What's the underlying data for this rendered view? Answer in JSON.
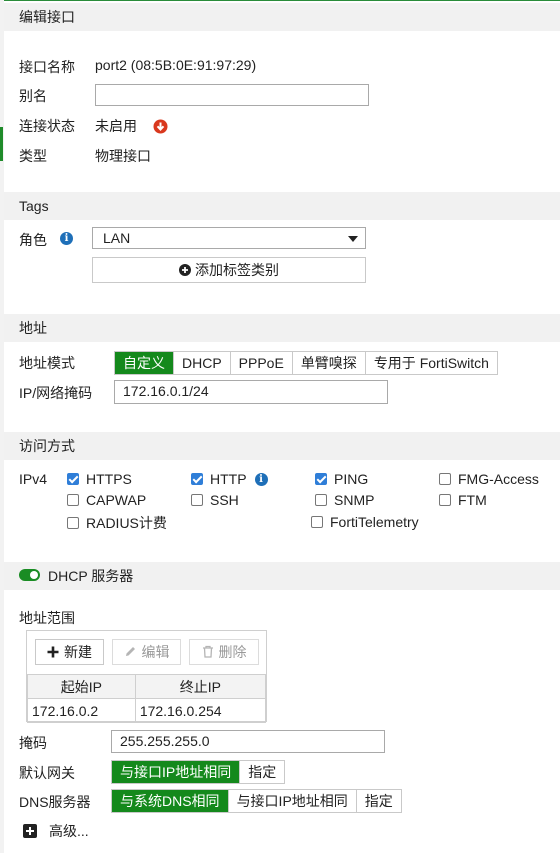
{
  "header": {
    "title": "编辑接口"
  },
  "interface": {
    "name_label": "接口名称",
    "name_value": "port2 (08:5B:0E:91:97:29)",
    "alias_label": "别名",
    "alias_value": "",
    "status_label": "连接状态",
    "status_value": "未启用",
    "type_label": "类型",
    "type_value": "物理接口"
  },
  "tags": {
    "title": "Tags",
    "role_label": "角色",
    "role_value": "LAN",
    "add_tag_label": "添加标签类别"
  },
  "address": {
    "title": "地址",
    "mode_label": "地址模式",
    "modes": [
      "自定义",
      "DHCP",
      "PPPoE",
      "单臂嗅探",
      "专用于 FortiSwitch"
    ],
    "selected_mode": "自定义",
    "ip_label": "IP/网络掩码",
    "ip_value": "172.16.0.1/24"
  },
  "access": {
    "title": "访问方式",
    "ipv4_label": "IPv4",
    "options": [
      {
        "label": "HTTPS",
        "checked": true
      },
      {
        "label": "HTTP",
        "checked": true
      },
      {
        "label": "PING",
        "checked": true
      },
      {
        "label": "FMG-Access",
        "checked": false
      },
      {
        "label": "CAPWAP",
        "checked": false
      },
      {
        "label": "SSH",
        "checked": false
      },
      {
        "label": "SNMP",
        "checked": false
      },
      {
        "label": "FTM",
        "checked": false
      },
      {
        "label": "RADIUS计费",
        "checked": false
      },
      {
        "label": "FortiTelemetry",
        "checked": false
      }
    ]
  },
  "dhcp": {
    "title": "DHCP 服务器",
    "enabled": true,
    "range_label": "地址范围",
    "toolbar": {
      "new_label": "新建",
      "edit_label": "编辑",
      "delete_label": "删除"
    },
    "columns": [
      "起始IP",
      "终止IP"
    ],
    "rows": [
      [
        "172.16.0.2",
        "172.16.0.254"
      ]
    ],
    "mask_label": "掩码",
    "mask_value": "255.255.255.0",
    "gateway_label": "默认网关",
    "gateway_options": [
      "与接口IP地址相同",
      "指定"
    ],
    "dns_label": "DNS服务器",
    "dns_options": [
      "与系统DNS相同",
      "与接口IP地址相同",
      "指定"
    ],
    "advanced_label": "高级..."
  },
  "colors": {
    "accent": "#14891c",
    "info": "#1e6fb8",
    "status_down": "#d9381e",
    "checkbox": "#2f7ed8"
  }
}
